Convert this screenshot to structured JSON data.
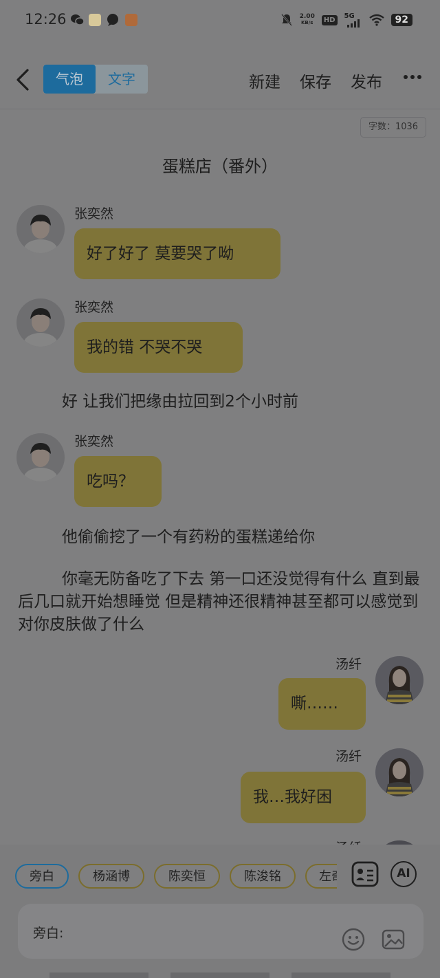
{
  "status_bar": {
    "time": "12:26",
    "net_speed_value": "2.00",
    "net_speed_unit": "KB/s",
    "hd": "HD",
    "signal": "5G",
    "battery": "92"
  },
  "toolbar": {
    "mode_bubble": "气泡",
    "mode_text": "文字",
    "new_label": "新建",
    "save_label": "保存",
    "publish_label": "发布"
  },
  "document": {
    "word_count": "字数：1036",
    "title": "蛋糕店（番外）",
    "messages": [
      {
        "sender": "张奕然",
        "text": "好了好了 莫要哭了呦"
      },
      {
        "sender": "张奕然",
        "text": "我的错 不哭不哭"
      },
      {
        "narration": "好 让我们把缘由拉回到2个小时前"
      },
      {
        "sender": "张奕然",
        "text": "吃吗？"
      },
      {
        "narration": "他偷偷挖了一个有药粉的蛋糕递给你"
      },
      {
        "narration": "你毫无防备吃了下去 第一口还没觉得有什么 直到最后几口就开始想睡觉 但是精神还很精神甚至都可以感觉到对你皮肤做了什么"
      },
      {
        "sender": "汤纤",
        "text": "嘶……"
      },
      {
        "sender": "汤纤",
        "text": "我…我好困"
      },
      {
        "sender": "汤纤",
        "text": ""
      }
    ]
  },
  "roles": [
    "旁白",
    "杨涵博",
    "陈奕恒",
    "陈浚铭",
    "左奇"
  ],
  "composer": {
    "label": "旁白:",
    "ai_label": "AI"
  },
  "colors": {
    "bubble": "#7f7438",
    "accent": "#1d6b9d",
    "overlay_bg": "#7f7f80"
  }
}
